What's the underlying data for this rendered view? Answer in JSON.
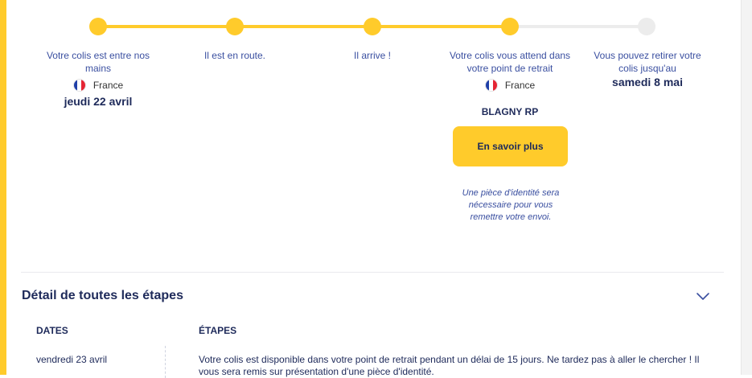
{
  "colors": {
    "accent": "#ffcb2b",
    "text_dark": "#1e2a5a",
    "text_link": "#3a4fa0",
    "track_empty": "#ececec"
  },
  "tracking": {
    "progress_completed_steps": 4,
    "progress_total_steps": 5,
    "steps": [
      {
        "text": "Votre colis est entre nos mains",
        "country": "France",
        "flag_icon": "france-flag-icon",
        "date": "jeudi 22 avril",
        "status": "done"
      },
      {
        "text": "Il est en route.",
        "status": "done"
      },
      {
        "text": "Il arrive !",
        "status": "done"
      },
      {
        "text": "Votre colis vous attend dans votre point de retrait",
        "country": "France",
        "flag_icon": "france-flag-icon",
        "location": "BLAGNY RP",
        "status": "done"
      },
      {
        "text": "Vous pouvez retirer votre colis jusqu'au",
        "deadline": "samedi 8 mai",
        "status": "pending"
      }
    ],
    "cta_label": "En savoir plus",
    "id_note": "Une pièce d'identité sera nécessaire pour vous remettre votre envoi."
  },
  "details": {
    "title": "Détail de toutes les étapes",
    "toggle_icon": "chevron-down-icon",
    "columns": {
      "dates": "DATES",
      "steps": "ÉTAPES"
    },
    "rows": [
      {
        "date": "vendredi 23 avril",
        "text": "Votre colis est disponible dans votre point de retrait pendant un délai de 15 jours. Ne tardez pas à aller le chercher ! Il vous sera remis sur présentation d'une pièce d'identité."
      }
    ]
  }
}
